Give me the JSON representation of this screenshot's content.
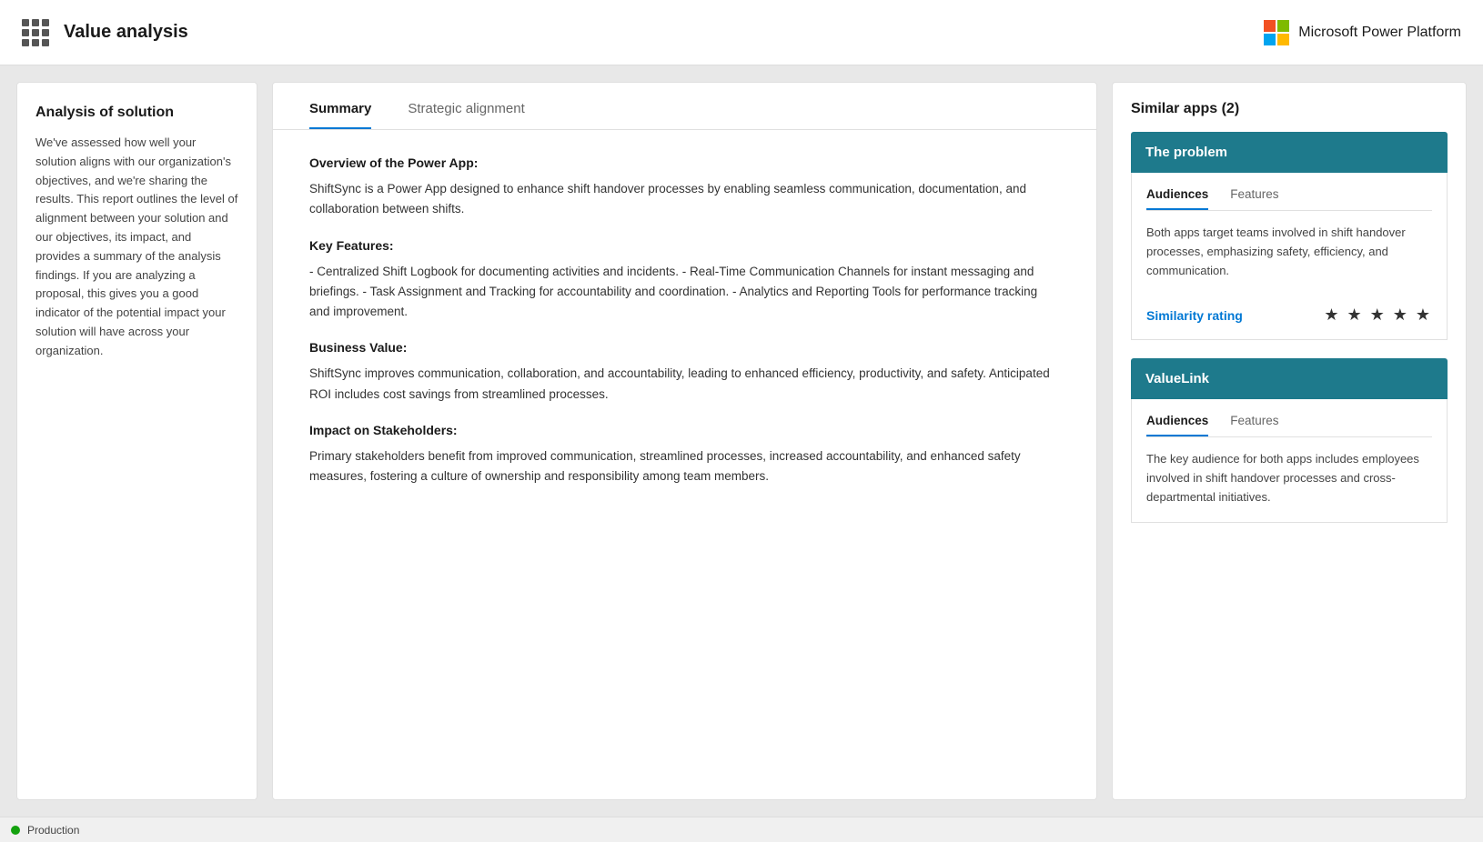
{
  "header": {
    "title": "Value analysis",
    "ms_logo_text": "Microsoft Power Platform"
  },
  "left_panel": {
    "title": "Analysis of solution",
    "text": "We've assessed how well your solution aligns with our organization's objectives, and we're sharing the results. This report outlines the level of alignment between your solution and our objectives, its impact, and provides a summary of the analysis findings. If you are analyzing a proposal, this gives you a good indicator of the potential impact your solution will have across your organization."
  },
  "middle_panel": {
    "tabs": [
      {
        "label": "Summary",
        "active": true
      },
      {
        "label": "Strategic alignment",
        "active": false
      }
    ],
    "sections": [
      {
        "heading": "Overview of the Power App:",
        "text": "ShiftSync is a Power App designed to enhance shift handover processes by enabling seamless communication, documentation, and collaboration between shifts."
      },
      {
        "heading": "Key Features:",
        "text": "- Centralized Shift Logbook for documenting activities and incidents. - Real-Time Communication Channels for instant messaging and briefings. - Task Assignment and Tracking for accountability and coordination. - Analytics and Reporting Tools for performance tracking and improvement."
      },
      {
        "heading": "Business Value:",
        "text": "ShiftSync improves communication, collaboration, and accountability, leading to enhanced efficiency, productivity, and safety. Anticipated ROI includes cost savings from streamlined processes."
      },
      {
        "heading": "Impact on Stakeholders:",
        "text": "Primary stakeholders benefit from improved communication, streamlined processes, increased accountability, and enhanced safety measures, fostering a culture of ownership and responsibility among team members."
      }
    ]
  },
  "right_panel": {
    "title": "Similar apps (2)",
    "apps": [
      {
        "name": "The problem",
        "tabs": [
          "Audiences",
          "Features"
        ],
        "active_tab": "Audiences",
        "audiences_text": "Both apps target teams involved in shift handover processes, emphasizing safety, efficiency, and communication.",
        "similarity_label": "Similarity rating",
        "stars": "★ ★ ★ ★ ★"
      },
      {
        "name": "ValueLink",
        "tabs": [
          "Audiences",
          "Features"
        ],
        "active_tab": "Audiences",
        "audiences_text": "The key audience for both apps includes employees involved in shift handover processes and cross-departmental initiatives.",
        "similarity_label": "",
        "stars": ""
      }
    ]
  },
  "status_bar": {
    "indicator": "Production"
  }
}
